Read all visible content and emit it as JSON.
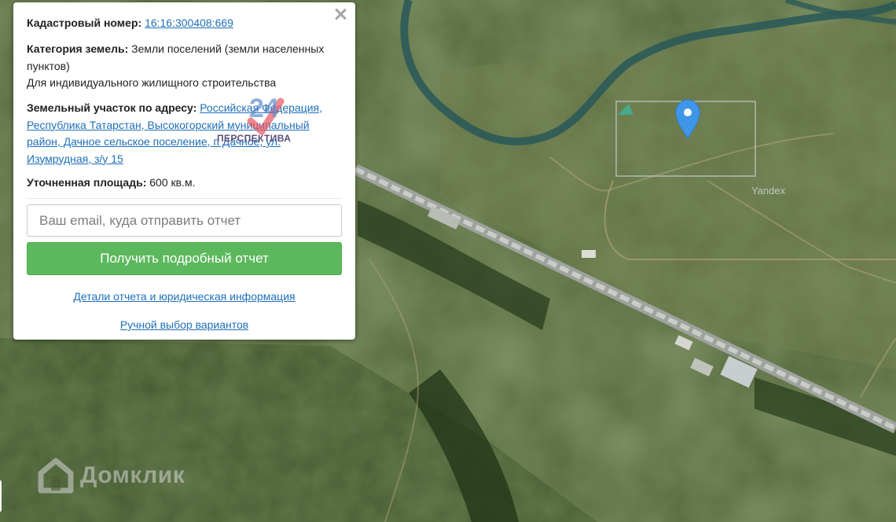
{
  "popup": {
    "cadastral_label": "Кадастровый номер:",
    "cadastral_value": "16:16:300408:669",
    "category_label": "Категория земель:",
    "category_value": "Земли поселений (земли населенных пунктов)",
    "category_usage": "Для индивидуального жилищного строительства",
    "address_label": "Земельный участок по адресу:",
    "address_value": "Российская Федерация, Республика Татарстан, Высокогорский муниципальный район, Дачное сельское поселение, п Дачное, ул. Изумрудная, з/у 15",
    "area_label": "Уточненная площадь:",
    "area_value": "600 кв.м.",
    "email_placeholder": "Ваш email, куда отправить отчет",
    "email_value": "",
    "submit_label": "Получить подробный отчет",
    "details_link": "Детали отчета и юридическая информация",
    "manual_link": "Ручной выбор вариантов"
  },
  "watermark": {
    "text": "ПЕРСПЕКТИВА",
    "glyph": "24"
  },
  "map": {
    "provider_label": "Yandex",
    "brand_label": "Домклик",
    "marker_color": "#3f95e8",
    "road_color": "#bfc3c0"
  },
  "icons": {
    "close": "close-icon",
    "marker": "map-pin-icon",
    "brand": "domclick-logo-icon"
  }
}
